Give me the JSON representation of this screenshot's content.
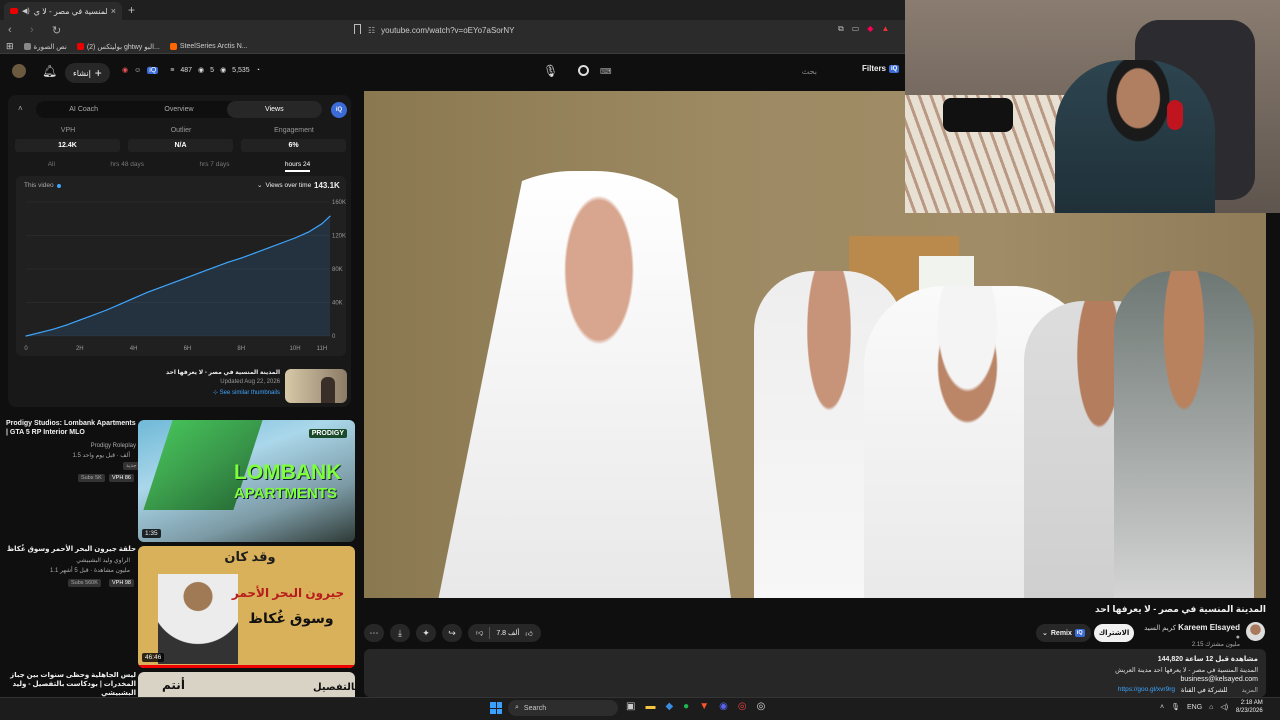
{
  "browser": {
    "tab_title": "المدينة المنسية في مصر - لا ي",
    "tab_close": "×",
    "new_tab": "+",
    "url": "youtube.com/watch?v=oEYo7aSorNY",
    "bookmarks": [
      {
        "label": "نص الصورة"
      },
      {
        "label": "(2) بوليتكس ghtwy البو..."
      },
      {
        "label": "SteelSeries Arctis N..."
      }
    ]
  },
  "header": {
    "create_label": "إنشاء",
    "stats_views": "487",
    "stats_mid": "5",
    "stats_count": "5,535",
    "search_placeholder": "بحث",
    "filters_label": "Filters"
  },
  "analytics": {
    "tabs": [
      "AI Coach",
      "Overview",
      "Views"
    ],
    "active_tab": "Views",
    "metrics": [
      {
        "label": "VPH",
        "value": "12.4K"
      },
      {
        "label": "Outlier",
        "value": "N/A"
      },
      {
        "label": "Engagement",
        "value": "6%"
      }
    ],
    "ranges": [
      "All",
      "hrs 48 days",
      "hrs 7 days",
      "hours 24"
    ],
    "active_range": "hours 24",
    "this_video_label": "This video",
    "views_over_time_label": "Views over time",
    "total_views": "143.1K"
  },
  "chart_data": {
    "type": "area",
    "title": "Views over time",
    "x": [
      0,
      0.5,
      1,
      1.5,
      2,
      2.5,
      3,
      3.5,
      4,
      4.5,
      5,
      5.5,
      6,
      6.5,
      7,
      7.5,
      8,
      8.5,
      9,
      9.5,
      10,
      10.5,
      11,
      11.3
    ],
    "y": [
      0,
      4000,
      8000,
      13000,
      19000,
      25000,
      31000,
      38000,
      45000,
      52000,
      58000,
      64000,
      70000,
      76000,
      82000,
      88000,
      93000,
      99000,
      105000,
      111000,
      117000,
      124000,
      134000,
      143000
    ],
    "x_ticks": [
      "0",
      "2H",
      "4H",
      "6H",
      "8H",
      "10H",
      "11H"
    ],
    "x_tick_values": [
      0,
      2,
      4,
      6,
      8,
      10,
      11
    ],
    "y_ticks": [
      "0",
      "40K",
      "80K",
      "120K",
      "160K"
    ],
    "y_tick_values": [
      0,
      40000,
      80000,
      120000,
      160000
    ],
    "xlim": [
      0,
      11.3
    ],
    "ylim": [
      0,
      160000
    ],
    "grid": true,
    "line_color": "#3ea6ff"
  },
  "thumbnail_row": {
    "title": "المدينة المنسية في مصر - لا يعرفها احد",
    "updated": "Updated Aug 22, 2026",
    "similar_link": "See similar thumbnails"
  },
  "recommendations": [
    {
      "title": "Prodigy Studios: Lombank Apartments | GTA 5 RP Interior MLO",
      "channel": "Prodigy Roleplay",
      "meta": "1.5 ألف · قبل يوم واحد",
      "badge": "جديد",
      "subs": "Subs 5K",
      "vph": "VPH 86",
      "thumb_text_1": "LOMBANK",
      "thumb_text_2": "APARTMENTS",
      "thumb_logo": "PRODIGY",
      "duration": "1:35"
    },
    {
      "title": "حلقة جيرون البحر الأحمر وسوق غُكاظ",
      "channel": "الراوي وليد البشبيشي",
      "meta": "1.1 مليون مشاهدة · قبل 5 أشهر",
      "subs": "Subs 560K",
      "vph": "VPH 98",
      "thumb_text_1": "وقد كان",
      "thumb_text_2": "جيرون البحر الأحمر",
      "thumb_text_3": "وسوق غُكاظ",
      "duration": "46:46"
    },
    {
      "title": "ليس الجاهلية وحظى سنوات بين جباز المخدرات | بودكاست بالتفصيل - وليد البشبيشي",
      "thumb_text_1": "بالتفصيل",
      "thumb_text_2": "أنتم"
    }
  ],
  "video": {
    "title": "المدينة المنسية في مصر - لا يعرفها احد",
    "channel_name": "Kareem Elsayed",
    "channel_prefix": "كريم السيد",
    "subscribers": "2.15 مليون مشترك",
    "subscribe_label": "الاشتراك",
    "remix_label": "Remix",
    "likes": "7.8 ألف",
    "views_line": "144,820 مشاهدة قبل 12 ساعة",
    "desc_line1": "المدينة المنسية في مصر - لا يعرفها احد مدينة العريش",
    "desc_email": "business@kelsayed.com",
    "desc_link": "https://goo.gl/xvr9rg",
    "desc_link_label": "للشركة في القناة",
    "more_label": "المزيد"
  },
  "taskbar": {
    "search_label": "Search",
    "lang": "ENG",
    "time": "2:18 AM",
    "date": "8/23/2026"
  }
}
